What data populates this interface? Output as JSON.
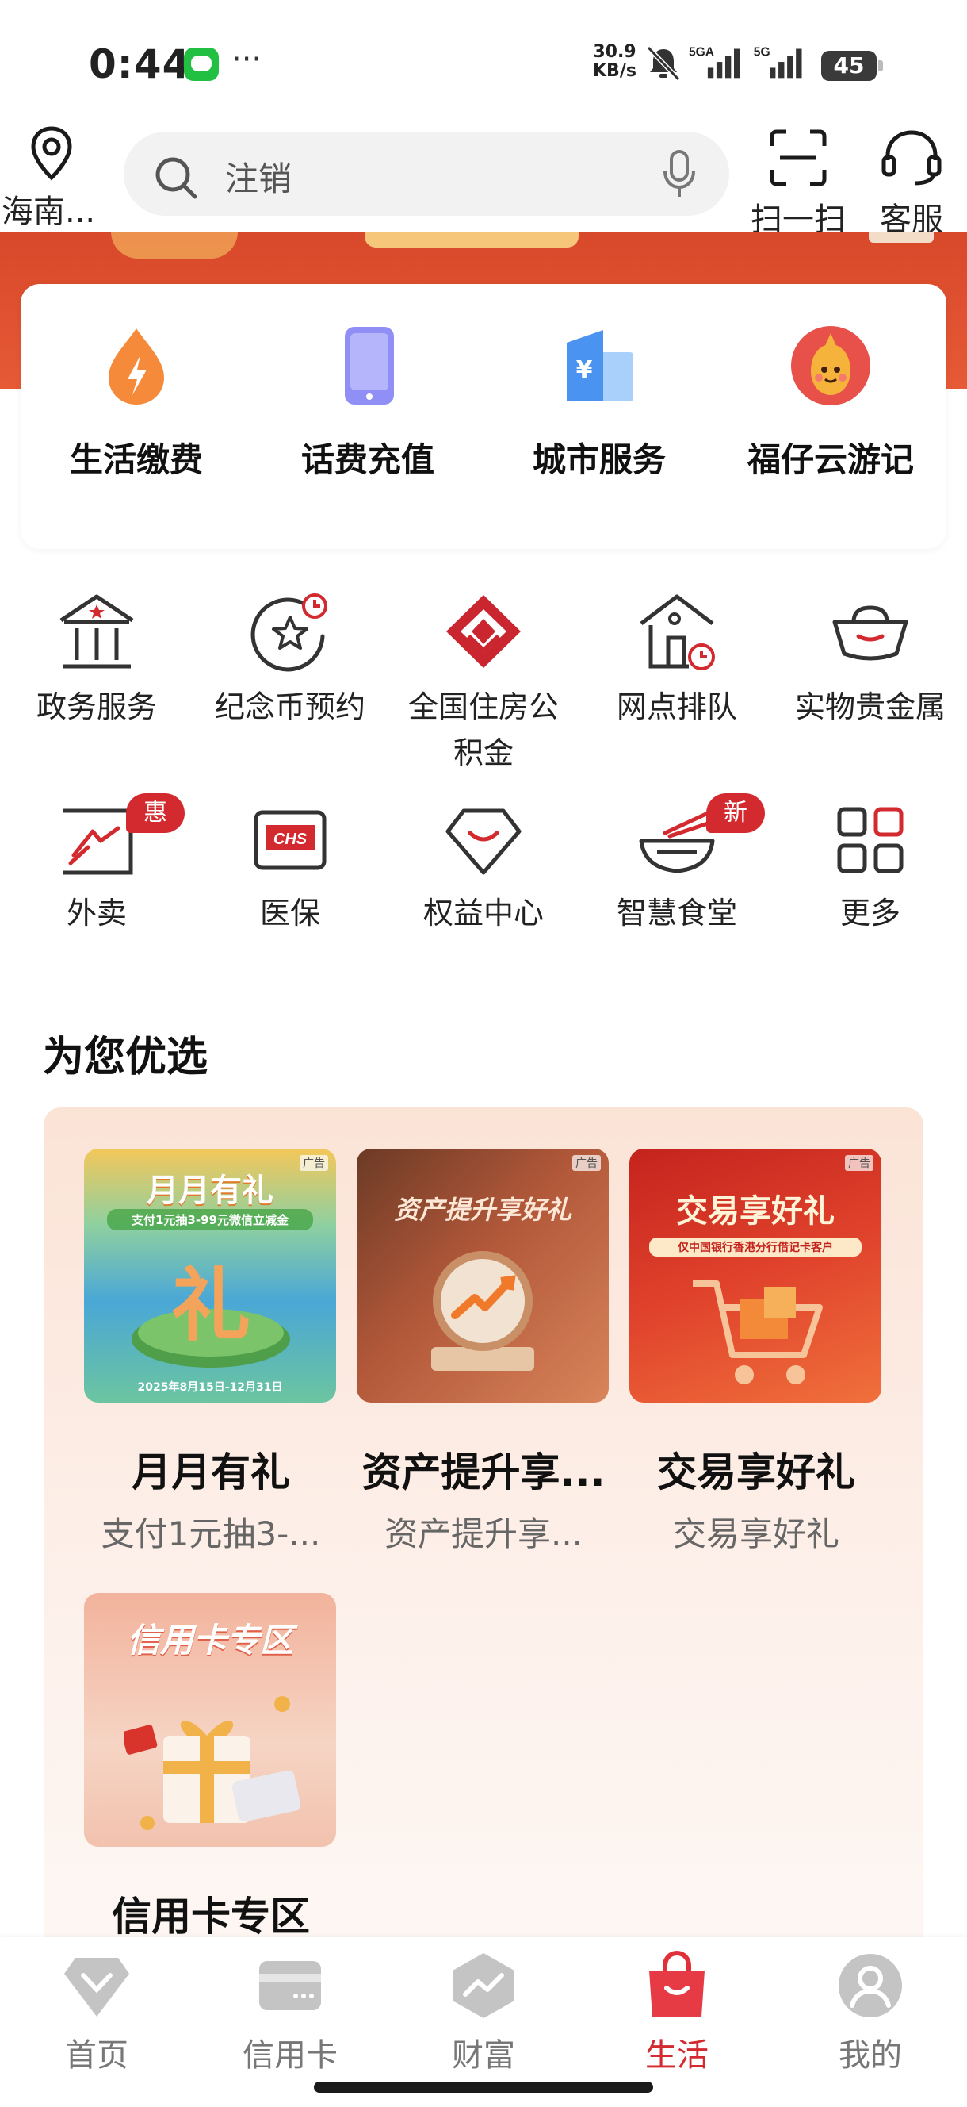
{
  "status_bar": {
    "time": "0:44",
    "speed_value": "30.9",
    "speed_unit": "KB/s",
    "network1": "5GA",
    "network2": "5G",
    "battery": "45"
  },
  "top_bar": {
    "location": "海南...",
    "search_placeholder": "注销",
    "scan_label": "扫一扫",
    "service_label": "客服"
  },
  "quick_services": [
    {
      "label": "生活缴费",
      "icon": "flame-droplet-icon"
    },
    {
      "label": "话费充值",
      "icon": "phone-icon"
    },
    {
      "label": "城市服务",
      "icon": "building-yuan-icon"
    },
    {
      "label": "福仔云游记",
      "icon": "mascot-icon"
    }
  ],
  "services_row1": [
    {
      "label": "政务服务",
      "icon": "government-building-icon"
    },
    {
      "label": "纪念币预约",
      "icon": "star-coin-clock-icon"
    },
    {
      "label": "全国住房公积金",
      "icon": "housing-fund-logo-icon"
    },
    {
      "label": "网点排队",
      "icon": "branch-queue-icon"
    },
    {
      "label": "实物贵金属",
      "icon": "gold-ingot-icon"
    }
  ],
  "services_row2": [
    {
      "label": "外卖",
      "icon": "takeaway-icon",
      "badge": "惠"
    },
    {
      "label": "医保",
      "icon": "chs-card-icon"
    },
    {
      "label": "权益中心",
      "icon": "diamond-smile-icon"
    },
    {
      "label": "智慧食堂",
      "icon": "bowl-chopsticks-icon",
      "badge": "新"
    },
    {
      "label": "更多",
      "icon": "grid-more-icon"
    }
  ],
  "section": {
    "title": "为您优选"
  },
  "promos": [
    {
      "title": "月月有礼",
      "subtitle": "支付1元抽3-...",
      "image_text": "月月有礼",
      "image_sub": "支付1元抽3-99元微信立减金",
      "image_date": "2025年8月15日-12月31日",
      "ad": "广告"
    },
    {
      "title": "资产提升享...",
      "subtitle": "资产提升享...",
      "image_text": "资产提升享好礼",
      "ad": "广告"
    },
    {
      "title": "交易享好礼",
      "subtitle": "交易享好礼",
      "image_text": "交易享好礼",
      "image_sub": "仅中国银行香港分行借记卡客户",
      "ad": "广告"
    },
    {
      "title": "信用卡专区",
      "subtitle": "",
      "image_text": "信用卡专区"
    }
  ],
  "bottom_nav": [
    {
      "label": "首页",
      "icon": "home-diamond-icon",
      "active": false
    },
    {
      "label": "信用卡",
      "icon": "credit-card-icon",
      "active": false
    },
    {
      "label": "财富",
      "icon": "wealth-chart-icon",
      "active": false
    },
    {
      "label": "生活",
      "icon": "shopping-bag-icon",
      "active": true
    },
    {
      "label": "我的",
      "icon": "profile-icon",
      "active": false
    }
  ],
  "colors": {
    "brand_red": "#d32a2f",
    "banner_orange": "#e3502f",
    "search_bg": "#f2f2f2"
  }
}
